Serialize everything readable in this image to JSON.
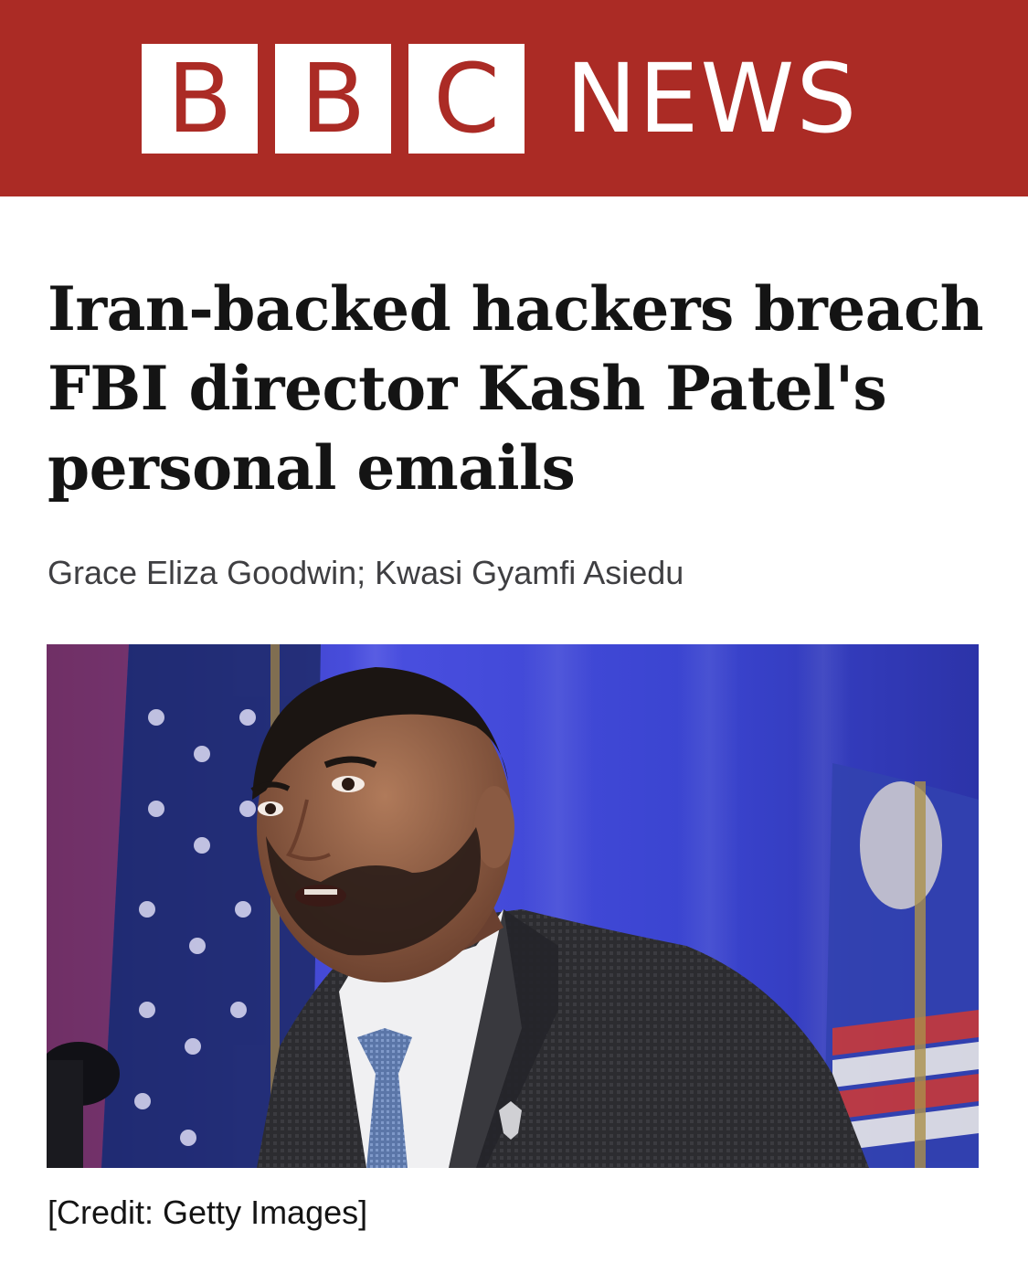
{
  "masthead": {
    "logo_letters": [
      "B",
      "B",
      "C"
    ],
    "logo_word": "NEWS",
    "brand_color": "#ab2b25"
  },
  "article": {
    "headline": "Iran-backed hackers breach FBI director Kash Patel's personal emails",
    "byline": "Grace Eliza Goodwin; Kwasi Gyamfi Asiedu",
    "image_credit": "[Credit: Getty Images]"
  }
}
